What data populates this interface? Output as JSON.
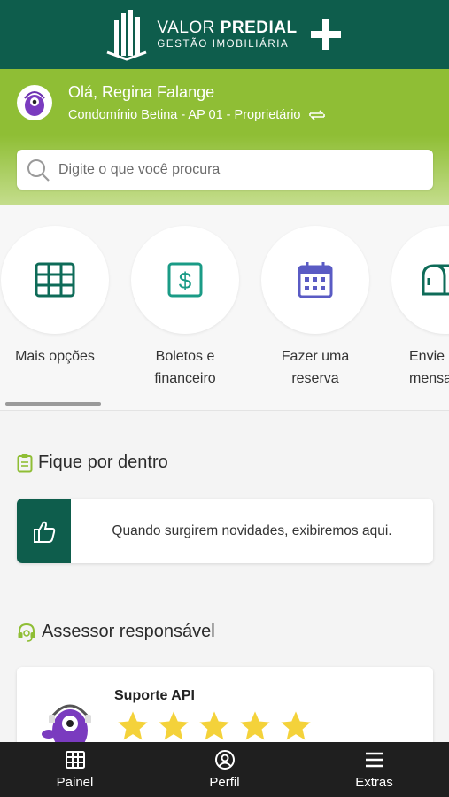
{
  "header": {
    "logo_word1": "VALOR",
    "logo_word2": "PREDIAL",
    "logo_tagline": "GESTÃO IMOBILIÁRIA"
  },
  "user": {
    "greeting": "Olá, Regina Falange",
    "unit": "Condomínio Betina - AP 01 - Proprietário"
  },
  "search": {
    "placeholder": "Digite o que você procura"
  },
  "shortcuts": [
    {
      "label_l1": "Mais opções",
      "label_l2": "",
      "icon": "grid-icon"
    },
    {
      "label_l1": "Boletos e",
      "label_l2": "financeiro",
      "icon": "dollar-icon"
    },
    {
      "label_l1": "Fazer uma",
      "label_l2": "reserva",
      "icon": "calendar-icon"
    },
    {
      "label_l1": "Envie",
      "label_l2": "mensa",
      "icon": "mailbox-icon"
    }
  ],
  "news": {
    "title": "Fique por dentro",
    "empty_text": "Quando surgirem novidades, exibiremos aqui."
  },
  "assessor": {
    "title": "Assessor responsável",
    "name": "Suporte API",
    "rating": 5
  },
  "bottom_nav": [
    {
      "label": "Painel",
      "icon": "grid-icon"
    },
    {
      "label": "Perfil",
      "icon": "user-icon"
    },
    {
      "label": "Extras",
      "icon": "menu-icon"
    }
  ],
  "colors": {
    "brand_dark": "#0e5d4c",
    "brand_green": "#8fbe35",
    "star": "#f4d23a",
    "nav_bg": "#1f1f1f"
  }
}
